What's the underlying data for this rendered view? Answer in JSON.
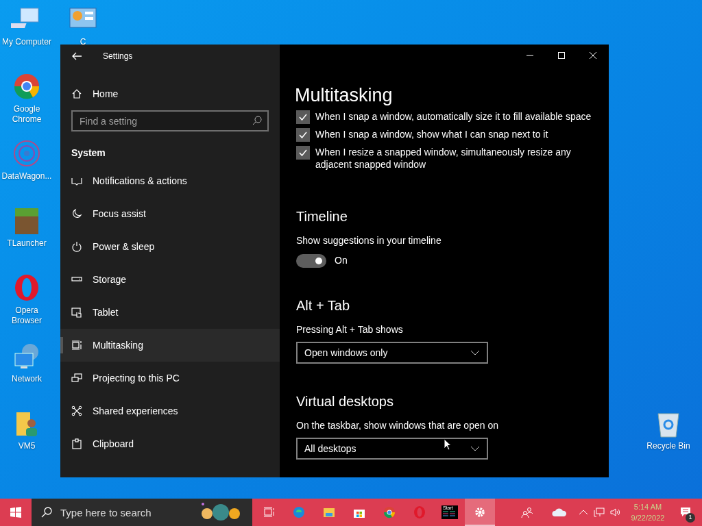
{
  "desktop_icons": [
    {
      "label": "My Computer",
      "kind": "computer"
    },
    {
      "label": "C",
      "kind": "panel"
    },
    {
      "label": "Google Chrome",
      "kind": "chrome"
    },
    {
      "label": "DataWagon...",
      "kind": "mandala"
    },
    {
      "label": "TLauncher",
      "kind": "grass"
    },
    {
      "label": "Opera Browser",
      "kind": "opera"
    },
    {
      "label": "Network",
      "kind": "network"
    },
    {
      "label": "VM5",
      "kind": "userfolder"
    },
    {
      "label": "Recycle Bin",
      "kind": "bin"
    }
  ],
  "window": {
    "title": "Settings",
    "sidebar": {
      "home": "Home",
      "search": {
        "placeholder": "Find a setting"
      },
      "section": "System",
      "items": [
        {
          "label": "Notifications & actions",
          "kind": "notify",
          "selected": false
        },
        {
          "label": "Focus assist",
          "kind": "moon",
          "selected": false
        },
        {
          "label": "Power & sleep",
          "kind": "power",
          "selected": false
        },
        {
          "label": "Storage",
          "kind": "storage",
          "selected": false
        },
        {
          "label": "Tablet",
          "kind": "tablet",
          "selected": false
        },
        {
          "label": "Multitasking",
          "kind": "multitask",
          "selected": true
        },
        {
          "label": "Projecting to this PC",
          "kind": "project",
          "selected": false
        },
        {
          "label": "Shared experiences",
          "kind": "share",
          "selected": false
        },
        {
          "label": "Clipboard",
          "kind": "clipboard",
          "selected": false
        }
      ]
    },
    "main": {
      "title": "Multitasking",
      "snap_options": [
        {
          "label": "When I snap a window, automatically size it to fill available space",
          "checked": true
        },
        {
          "label": "When I snap a window, show what I can snap next to it",
          "checked": true
        },
        {
          "label": "When I resize a snapped window, simultaneously resize any adjacent snapped window",
          "checked": true
        }
      ],
      "sections": [
        {
          "heading": "Timeline",
          "label": "Show suggestions in your timeline",
          "kind": "toggle",
          "on": true,
          "value": "On"
        },
        {
          "heading": "Alt + Tab",
          "label": "Pressing Alt + Tab shows",
          "kind": "dropdown",
          "value": "Open windows only"
        },
        {
          "heading": "Virtual desktops",
          "label": "On the taskbar, show windows that are open on",
          "kind": "dropdown",
          "value": "All desktops"
        }
      ]
    }
  },
  "taskbar": {
    "search": {
      "placeholder": "Type here to search"
    },
    "apps": [
      {
        "kind": "taskview",
        "active": false
      },
      {
        "kind": "edge",
        "active": false
      },
      {
        "kind": "explorer",
        "active": false
      },
      {
        "kind": "store",
        "active": false
      },
      {
        "kind": "chrome",
        "active": false
      },
      {
        "kind": "opera",
        "active": false
      },
      {
        "kind": "terminal",
        "active": false,
        "caption": "Start"
      },
      {
        "kind": "settings",
        "active": true
      }
    ],
    "time": "5:14 AM",
    "date": "9/22/2022",
    "notification_count": "1"
  }
}
